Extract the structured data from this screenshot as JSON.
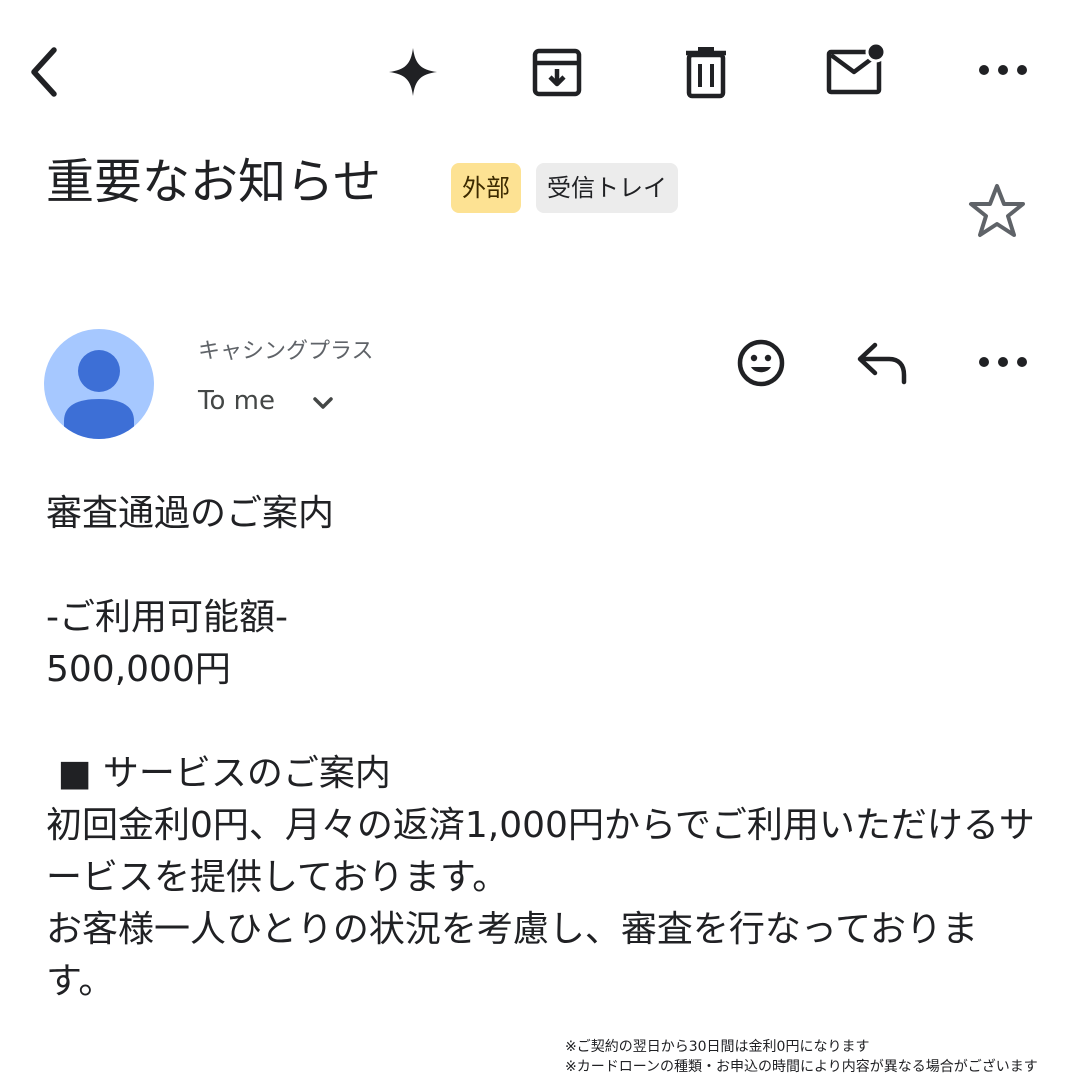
{
  "toolbar": {
    "back_icon": "arrow-back-icon",
    "gemini_icon": "sparkle-icon",
    "archive_icon": "archive-icon",
    "delete_icon": "trash-icon",
    "mark_unread_icon": "mail-unread-icon",
    "more_icon": "more-horizontal-icon"
  },
  "subject": {
    "title": "重要なお知らせ",
    "chips": [
      {
        "label": "外部",
        "color": "#fde293"
      },
      {
        "label": "受信トレイ",
        "color": "#ececec"
      }
    ],
    "star_icon": "star-outline-icon"
  },
  "sender": {
    "name": "キャシングプラス",
    "recipient": "To me",
    "avatar_color": "#a6c8ff",
    "avatar_figure_color": "#3d6fd6",
    "emoji_icon": "smiley-icon",
    "reply_icon": "reply-icon",
    "more_icon": "more-horizontal-icon"
  },
  "body": {
    "line1": "審査通過のご案内",
    "line2": "-ご利用可能額-",
    "line3": "500,000円",
    "line4": " ■ サービスのご案内",
    "line5": "初回金利0円、月々の返済1,000円からでご利用いただけるサービスを提供しております。",
    "line6": "お客様一人ひとりの状況を考慮し、審査を行なっております。"
  },
  "footnotes": [
    "※ご契約の翌日から30日間は金利0円になります",
    "※カードローンの種類・お申込の時間により内容が異なる場合がございます"
  ]
}
